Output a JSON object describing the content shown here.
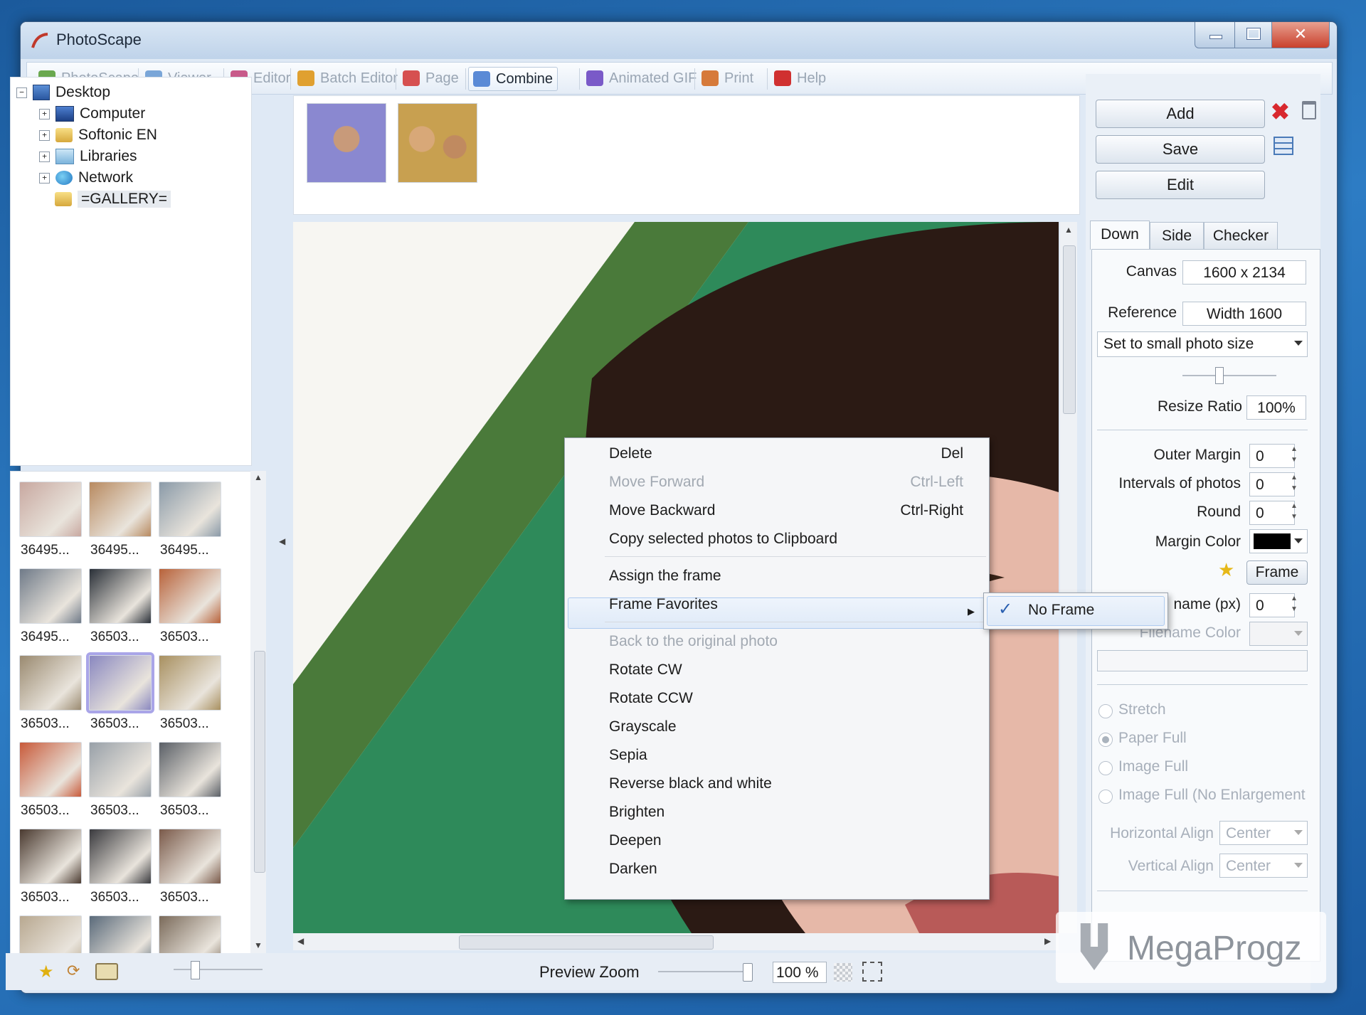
{
  "window": {
    "title": "PhotoScape"
  },
  "toolbar": {
    "tabs": [
      {
        "label": "PhotoScape",
        "color": "#6aa84f"
      },
      {
        "label": "Viewer",
        "color": "#7aa6d8"
      },
      {
        "label": "Editor",
        "color": "#c85a8a"
      },
      {
        "label": "Batch Editor",
        "color": "#e0a030"
      },
      {
        "label": "Page",
        "color": "#d65050"
      },
      {
        "label": "Combine",
        "color": "#5a8ad6"
      },
      {
        "label": "Animated GIF",
        "color": "#7a5ac8"
      },
      {
        "label": "Print",
        "color": "#d67a3a"
      },
      {
        "label": "Help",
        "color": "#d03030"
      }
    ],
    "active": "Combine"
  },
  "tree": {
    "root": "Desktop",
    "items": [
      "Computer",
      "Softonic EN",
      "Libraries",
      "Network",
      "=GALLERY="
    ]
  },
  "thumbs": {
    "labels": [
      "36495...",
      "36495...",
      "36495...",
      "36495...",
      "36503...",
      "36503...",
      "36503...",
      "36503...",
      "36503...",
      "36503...",
      "36503...",
      "36503...",
      "36503...",
      "36503...",
      "36503...",
      "",
      "",
      ""
    ],
    "colors": [
      "#c8a8a0",
      "#b88a60",
      "#8a9aa8",
      "#6f7a88",
      "#2a3038",
      "#b8623a",
      "#9a8a70",
      "#8a88c0",
      "#a89060",
      "#c85a3a",
      "#98a0a8",
      "#5a5f66",
      "#4a3a30",
      "#3a3a3e",
      "#7a5a4a",
      "#b8a890",
      "#5a6a7a",
      "#7a6a5a"
    ],
    "selected_index": 7
  },
  "strip": {
    "photo_colors": [
      "#8a88d0",
      "#c8a050"
    ]
  },
  "preview": {
    "zoom_label": "Preview Zoom",
    "zoom_value": "100 %",
    "zoom_fraction": 0.96
  },
  "right_panel": {
    "add_button": "Add",
    "save_button": "Save",
    "edit_button": "Edit",
    "tabs": [
      "Down",
      "Side",
      "Checker"
    ],
    "active_tab": "Down",
    "canvas_label": "Canvas",
    "canvas_value": "1600 x 2134",
    "reference_label": "Reference",
    "reference_value": "Width 1600",
    "size_mode": "Set to small photo size",
    "resize_label": "Resize Ratio",
    "resize_value": "100%",
    "outer_margin_label": "Outer Margin",
    "outer_margin_value": "0",
    "intervals_label": "Intervals of photos",
    "intervals_value": "0",
    "round_label": "Round",
    "round_value": "0",
    "margin_color_label": "Margin Color",
    "margin_color": "#000000",
    "frame_button": "Frame",
    "filename_px_label": "name (px)",
    "filename_px_value": "0",
    "filename_color_label": "Filename Color",
    "fit_options": [
      "Stretch",
      "Paper Full",
      "Image Full",
      "Image Full (No Enlargement"
    ],
    "fit_selected": "Paper Full",
    "halign_label": "Horizontal Align",
    "halign_value": "Center",
    "valign_label": "Vertical Align",
    "valign_value": "Center"
  },
  "context_menu": {
    "items": [
      {
        "label": "Delete",
        "shortcut": "Del",
        "enabled": true
      },
      {
        "label": "Move Forward",
        "shortcut": "Ctrl-Left",
        "enabled": false
      },
      {
        "label": "Move Backward",
        "shortcut": "Ctrl-Right",
        "enabled": true
      },
      {
        "label": "Copy selected photos to Clipboard",
        "shortcut": "",
        "enabled": true
      },
      {
        "label": "Assign the frame",
        "shortcut": "",
        "enabled": true
      },
      {
        "label": "Frame Favorites",
        "shortcut": "",
        "enabled": true
      },
      {
        "label": "Back to the original photo",
        "shortcut": "",
        "enabled": false
      },
      {
        "label": "Rotate CW",
        "shortcut": "",
        "enabled": true
      },
      {
        "label": "Rotate CCW",
        "shortcut": "",
        "enabled": true
      },
      {
        "label": "Grayscale",
        "shortcut": "",
        "enabled": true
      },
      {
        "label": "Sepia",
        "shortcut": "",
        "enabled": true
      },
      {
        "label": "Reverse black and white",
        "shortcut": "",
        "enabled": true
      },
      {
        "label": "Brighten",
        "shortcut": "",
        "enabled": true
      },
      {
        "label": "Deepen",
        "shortcut": "",
        "enabled": true
      },
      {
        "label": "Darken",
        "shortcut": "",
        "enabled": true
      }
    ],
    "submenu": {
      "label": "No Frame",
      "checked": true,
      "check_glyph": "✓"
    }
  },
  "watermark": {
    "text": "MegaProgz"
  }
}
